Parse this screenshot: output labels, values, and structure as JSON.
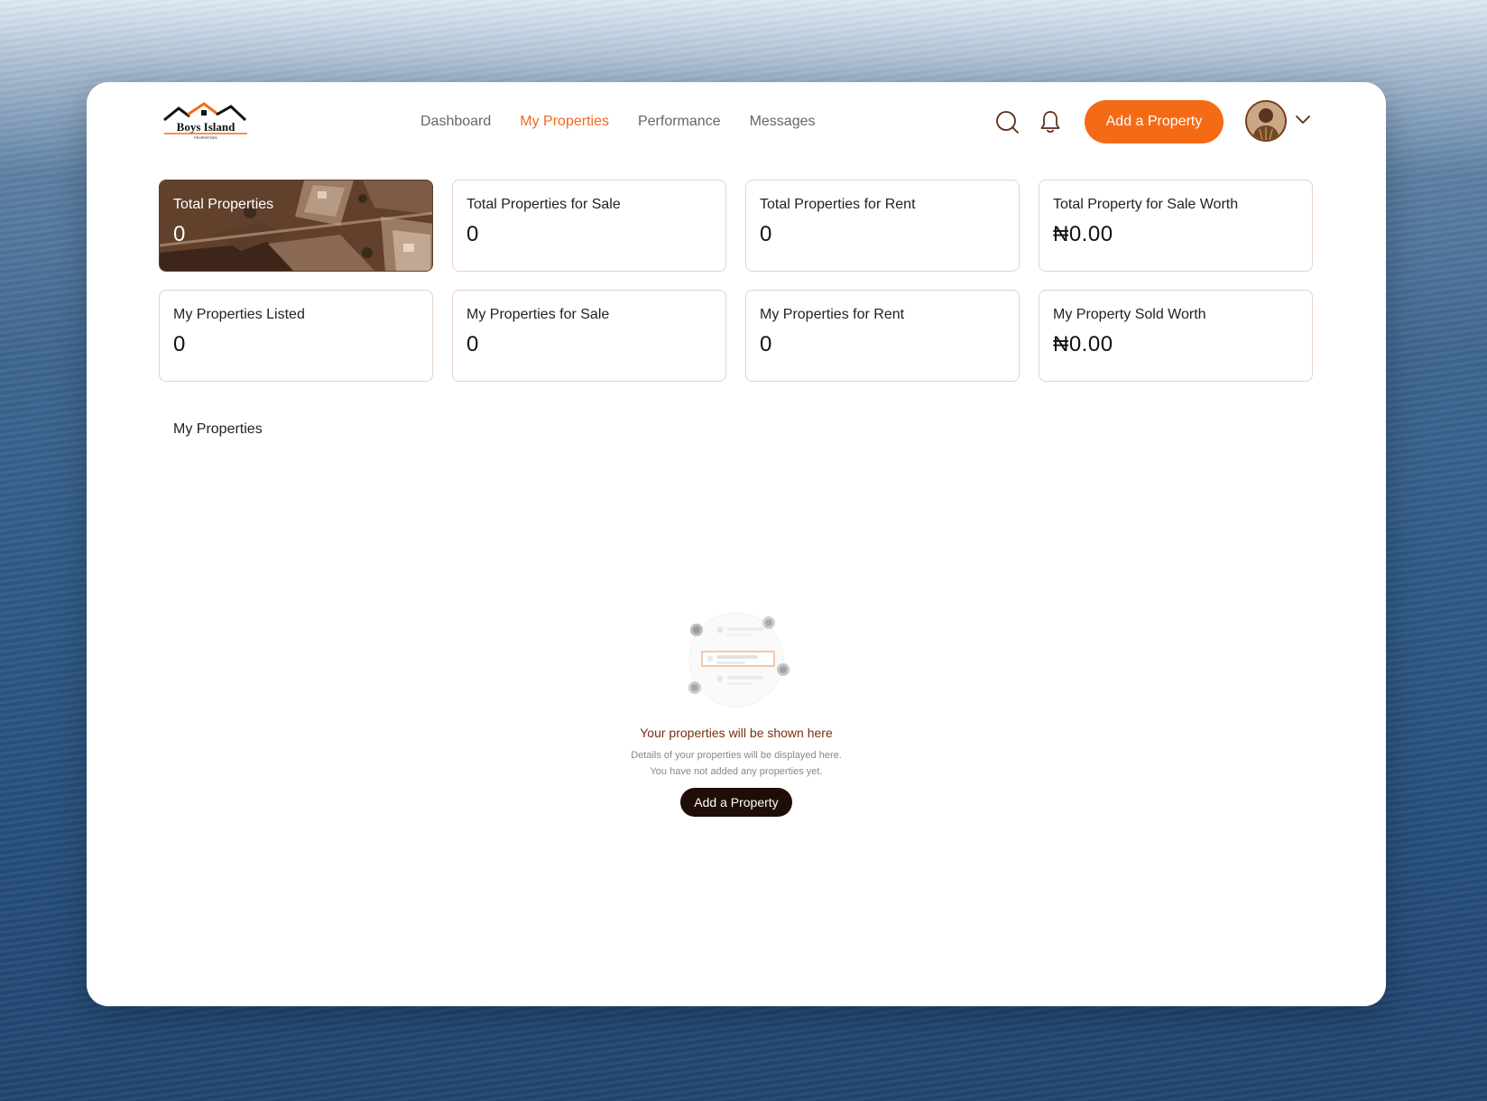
{
  "brand": {
    "logo_main": "Boys Island",
    "logo_sub": "PROPERTIES"
  },
  "nav": {
    "items": [
      {
        "label": "Dashboard",
        "active": false
      },
      {
        "label": "My Properties",
        "active": true
      },
      {
        "label": "Performance",
        "active": false
      },
      {
        "label": "Messages",
        "active": false
      }
    ]
  },
  "header": {
    "search_icon": "search-icon",
    "notification_icon": "bell-icon",
    "add_property_label": "Add a Property",
    "avatar_icon": "user-avatar",
    "menu_icon": "chevron-down-icon"
  },
  "stats": {
    "total_properties": {
      "label": "Total Properties",
      "value": "0"
    },
    "total_for_sale": {
      "label": "Total Properties for Sale",
      "value": "0"
    },
    "total_for_rent": {
      "label": "Total Properties for Rent",
      "value": "0"
    },
    "total_sale_worth": {
      "label": "Total Property for Sale Worth",
      "value": "₦0.00"
    },
    "my_listed": {
      "label": "My Properties Listed",
      "value": "0"
    },
    "my_for_sale": {
      "label": "My Properties for Sale",
      "value": "0"
    },
    "my_for_rent": {
      "label": "My Properties for Rent",
      "value": "0"
    },
    "my_sold_worth": {
      "label": "My Property Sold Worth",
      "value": "₦0.00"
    }
  },
  "section": {
    "title": "My Properties"
  },
  "empty_state": {
    "title": "Your properties will be shown here",
    "line1": "Details of your properties will be displayed here.",
    "line2": "You have not added any properties yet.",
    "button_label": "Add a Property"
  },
  "colors": {
    "accent": "#f56b15",
    "dark_button": "#1f0d07",
    "empty_title": "#7a2e0e",
    "card_border": "#e7d3c7"
  }
}
